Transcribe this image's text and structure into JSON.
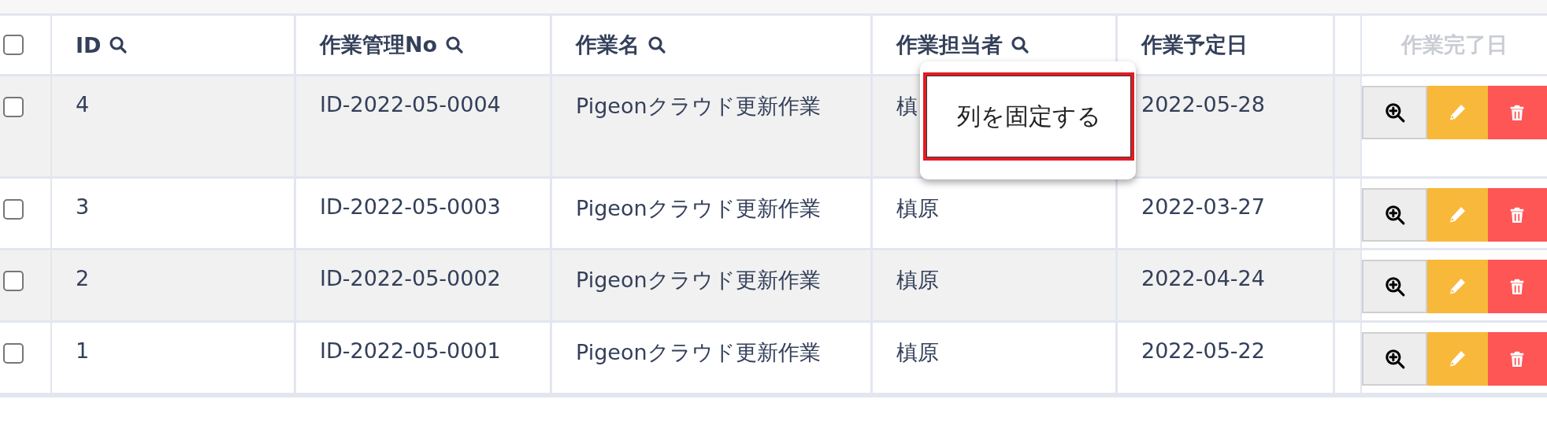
{
  "table": {
    "select_all": {
      "checked": false
    },
    "columns": [
      {
        "label": "ID",
        "kind": "text",
        "searchable": true
      },
      {
        "label": "作業管理No",
        "kind": "text",
        "searchable": true
      },
      {
        "label": "作業名",
        "kind": "text",
        "searchable": true
      },
      {
        "label": "作業担当者",
        "kind": "text",
        "searchable": true
      },
      {
        "label": "作業予定日",
        "kind": "text",
        "searchable": false
      },
      {
        "label": "作業完了日",
        "kind": "actions",
        "searchable": false
      }
    ],
    "rows": [
      {
        "checked": false,
        "cells": [
          "4",
          "ID-2022-05-0004",
          "Pigeonクラウド更新作業",
          "槙",
          "2022-05-28"
        ],
        "actions": [
          {
            "kind": "view"
          },
          {
            "kind": "edit"
          },
          {
            "kind": "delete"
          }
        ]
      },
      {
        "checked": false,
        "cells": [
          "3",
          "ID-2022-05-0003",
          "Pigeonクラウド更新作業",
          "槙原",
          "2022-03-27"
        ],
        "actions": [
          {
            "kind": "view"
          },
          {
            "kind": "edit"
          },
          {
            "kind": "delete"
          }
        ]
      },
      {
        "checked": false,
        "cells": [
          "2",
          "ID-2022-05-0002",
          "Pigeonクラウド更新作業",
          "槙原",
          "2022-04-24"
        ],
        "actions": [
          {
            "kind": "view"
          },
          {
            "kind": "edit"
          },
          {
            "kind": "delete"
          }
        ]
      },
      {
        "checked": false,
        "cells": [
          "1",
          "ID-2022-05-0001",
          "Pigeonクラウド更新作業",
          "槙原",
          "2022-05-22"
        ],
        "actions": [
          {
            "kind": "view"
          },
          {
            "kind": "edit"
          },
          {
            "kind": "delete"
          }
        ]
      }
    ]
  },
  "context_menu": {
    "items": [
      {
        "label": "列を固定する",
        "selected": true
      }
    ]
  }
}
